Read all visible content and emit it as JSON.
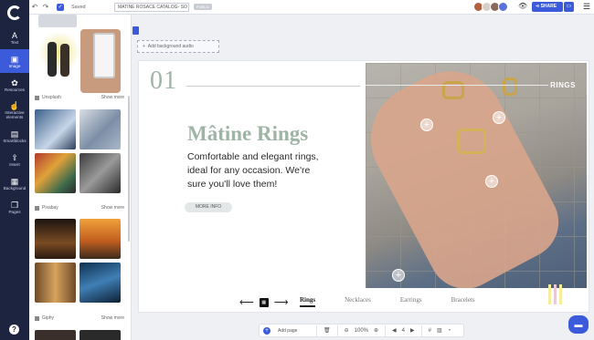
{
  "rail": {
    "items": [
      {
        "label": "Text",
        "icon": "A"
      },
      {
        "label": "Image",
        "icon": "▣"
      },
      {
        "label": "Resources",
        "icon": "✿"
      },
      {
        "label": "Interactive elements",
        "icon": "☝"
      },
      {
        "label": "Smartblocks",
        "icon": "▤"
      },
      {
        "label": "Insert",
        "icon": "⇪"
      },
      {
        "label": "Background",
        "icon": "▦"
      },
      {
        "label": "Pages",
        "icon": "❐"
      }
    ],
    "help": "?"
  },
  "topbar": {
    "undo": "↶",
    "redo": "↷",
    "saved": "Saved",
    "doc_title": "MATINE ROSACE CATALOG- SO",
    "public": "PUBLIC",
    "share": "SHARE",
    "menu": "☰"
  },
  "panel": {
    "sections": [
      {
        "name": "Unsplash",
        "show_more": "Show more"
      },
      {
        "name": "Pixabay",
        "show_more": "Show more"
      },
      {
        "name": "Giphy",
        "show_more": "Show more"
      }
    ]
  },
  "canvas": {
    "audio": "Add background audio",
    "number": "01",
    "heading": "Mâtine Rings",
    "body": "Comfortable and elegant rings, ideal for any occasion. We're sure you'll love them!",
    "more_info": "MORE INFO",
    "photo_label": "RINGS",
    "tabs": [
      "Rings",
      "Necklaces",
      "Earrings",
      "Bracelets"
    ],
    "active_tab": "Rings"
  },
  "bottombar": {
    "add_page": "Add page",
    "zoom": "100%",
    "page": "4"
  },
  "colors": {
    "accent": "#3b5bdb",
    "rail": "#1d2440",
    "sage": "#9fb3a7"
  }
}
